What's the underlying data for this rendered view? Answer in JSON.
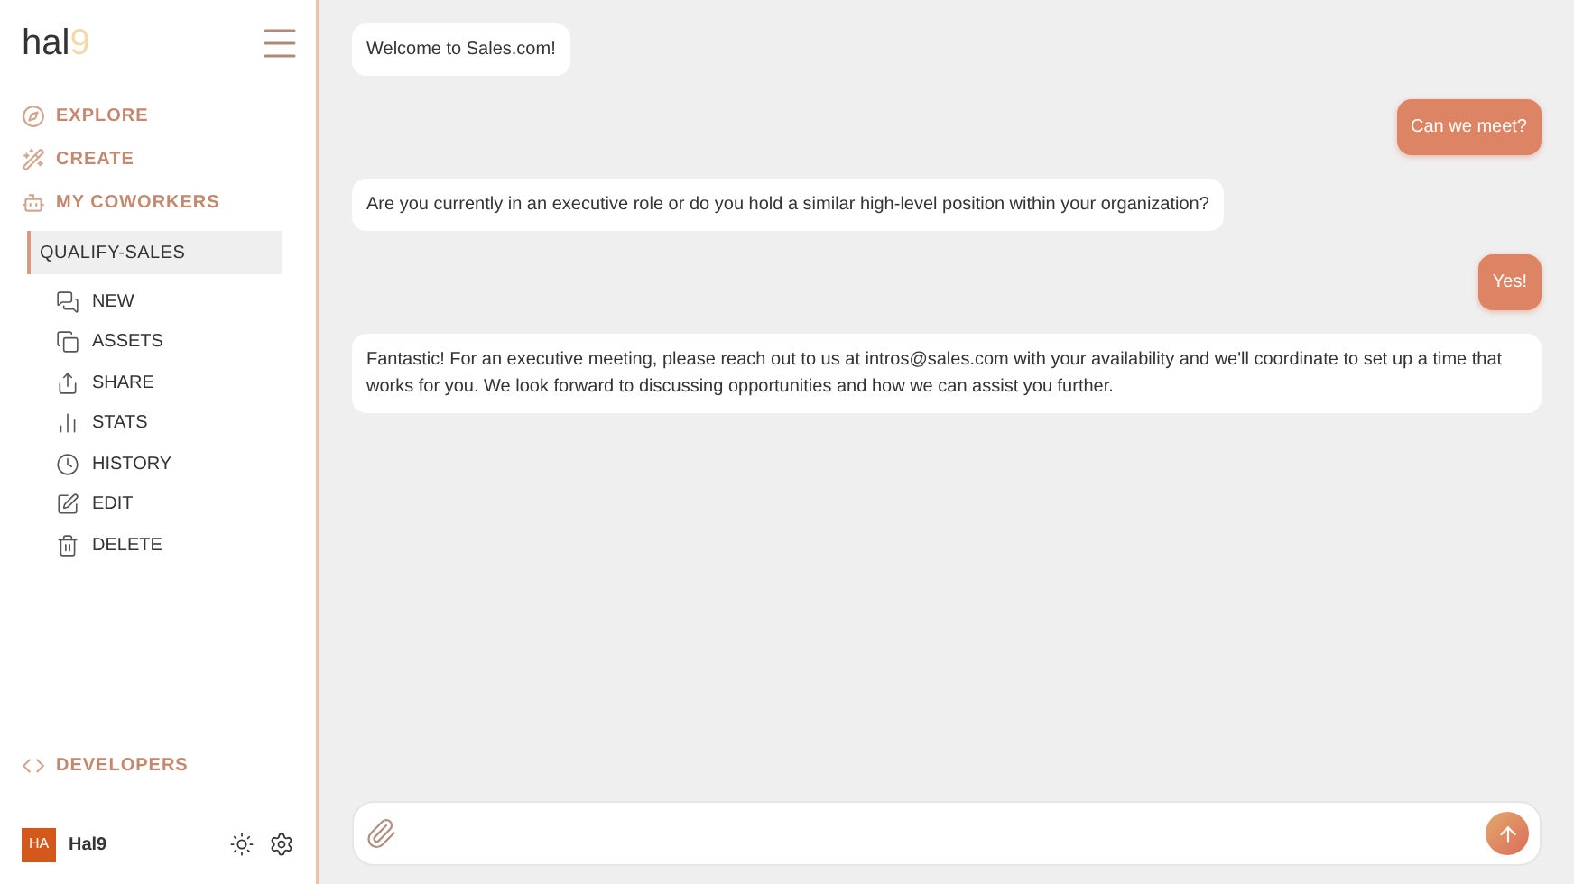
{
  "logo": {
    "word": "hal",
    "digit": "9"
  },
  "nav": [
    {
      "label": "EXPLORE"
    },
    {
      "label": "CREATE"
    },
    {
      "label": "MY COWORKERS"
    }
  ],
  "coworker": {
    "label": "QUALIFY-SALES",
    "selected": true,
    "actions": [
      {
        "label": "NEW",
        "selected": false
      },
      {
        "label": "ASSETS",
        "selected": false
      },
      {
        "label": "SHARE",
        "selected": false
      },
      {
        "label": "STATS",
        "selected": false
      },
      {
        "label": "HISTORY",
        "selected": false
      },
      {
        "label": "EDIT",
        "selected": false
      },
      {
        "label": "DELETE",
        "selected": false
      }
    ]
  },
  "developers": {
    "label": "DEVELOPERS"
  },
  "user": {
    "initials": "HA",
    "name": "Hal9"
  },
  "messages": [
    {
      "kind": "bot",
      "text": "Welcome to Sales.com!"
    },
    {
      "kind": "user",
      "text": "Can we meet?"
    },
    {
      "kind": "bot",
      "text": "Are you currently in an executive role or do you hold a similar high-level position within your organization?"
    },
    {
      "kind": "user",
      "text": "Yes!"
    },
    {
      "kind": "bot",
      "text": "Fantastic! For an executive meeting, please reach out to us at intros@sales.com with your availability and we'll coordinate to set up a time that works for you. We look forward to discussing opportunities and how we can assist you further."
    }
  ]
}
